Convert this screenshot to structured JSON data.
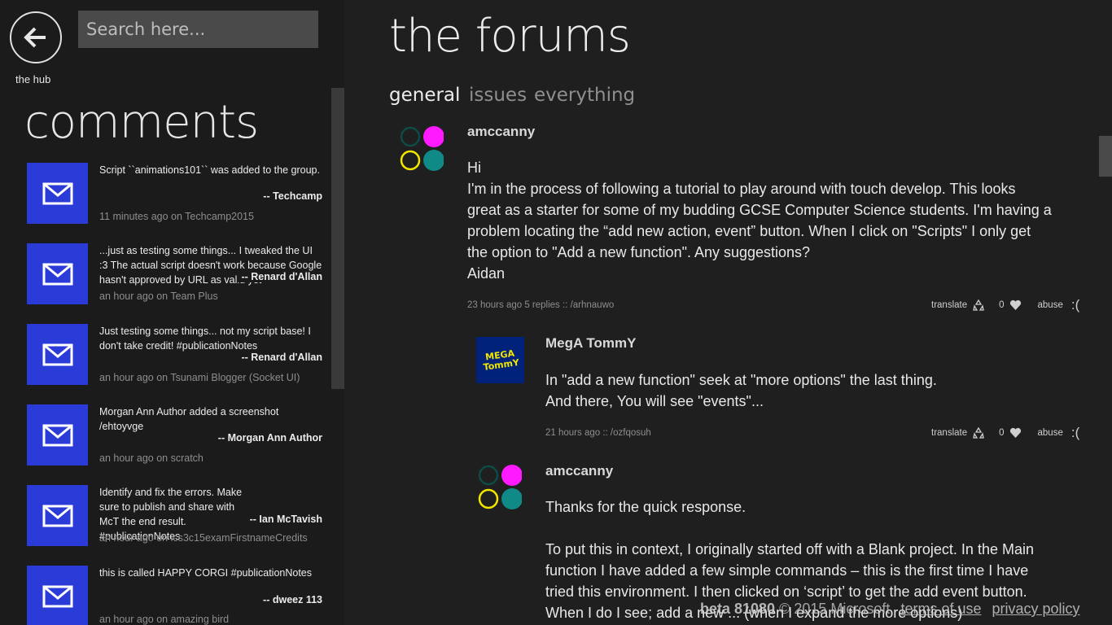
{
  "nav": {
    "back_label": "the hub"
  },
  "search": {
    "placeholder": "Search here..."
  },
  "sidebar": {
    "title": "comments",
    "items": [
      {
        "text": "Script ``animations101`` was added to the group.",
        "author": "-- Techcamp",
        "meta": "11 minutes ago on Techcamp2015"
      },
      {
        "text": "...just as testing some things... I tweaked the UI :3 The actual script doesn't work because Google hasn't approved by URL as valid yet",
        "author": "-- Renard d'Allan",
        "meta": "an hour ago on Team Plus"
      },
      {
        "text": "Just testing some things... not my script base! I don't take credit! #publicationNotes",
        "author": "-- Renard d'Allan",
        "meta": "an hour ago on Tsunami Blogger (Socket UI)"
      },
      {
        "text": "Morgan Ann Author added a screenshot /ehtoyvge",
        "author": "-- Morgan Ann Author",
        "meta": "an hour ago on scratch"
      },
      {
        "text": "Identify and fix the errors. Make sure to publish and share with McT the end result. #publicationNotes",
        "author": "-- Ian McTavish",
        "meta": "an hour ago on ics3c15examFirstnameCredits"
      },
      {
        "text": "this is called HAPPY CORGI #publicationNotes",
        "author": "-- dweez 113",
        "meta": "an hour ago on amazing bird"
      }
    ]
  },
  "main": {
    "title": "the forums",
    "tabs": [
      {
        "label": "general"
      },
      {
        "label": "issues"
      },
      {
        "label": "everything"
      }
    ]
  },
  "posts": [
    {
      "user": "amccanny",
      "lines": [
        "Hi",
        "I'm in the process of following a tutorial to play around with touch develop.  This looks",
        "great as a starter for some of my budding GCSE Computer Science students.  I'm having a",
        "problem locating the “add new action, event” button.  When I click on \"Scripts\" I only get",
        "the option to \"Add a new function\".  Any suggestions?",
        "Aidan"
      ],
      "meta": "23 hours ago 5 replies :: /arhnauwo",
      "translate": "translate",
      "likes": "0",
      "abuse": "abuse",
      "sad": ":("
    },
    {
      "user": "MegA TommY",
      "avatar_text": "MEGA TommY",
      "lines": [
        "In \"add a new function\" seek at \"more options\" the last thing.",
        "And there, You will see \"events\"..."
      ],
      "meta": "21 hours ago :: /ozfqosuh",
      "translate": "translate",
      "likes": "0",
      "abuse": "abuse",
      "sad": ":("
    },
    {
      "user": "amccanny",
      "lines": [
        "Thanks for the quick response.",
        "",
        "To put this in context, I originally started off with a Blank project.  In the Main",
        "function I have added a few simple commands – this is the first time I have",
        "tried this environment.  I then clicked on ‘script’ to get the add event button.",
        "When I do I see; add a new ... (when I expand the more options)"
      ]
    }
  ],
  "footer": {
    "beta": "beta 81080",
    "copyright": "© 2015 Microsoft",
    "terms": "terms of use",
    "privacy": "privacy policy"
  },
  "colors": {
    "tile": "#2b3bd8",
    "dot_magenta": "#ff1aff",
    "dot_teal": "#0f8a86",
    "dot_yellow": "#f2e600",
    "dot_darkteal": "#0d4a48"
  },
  "icons": [
    "back-arrow-icon",
    "envelope-icon",
    "recycle-icon",
    "heart-icon"
  ]
}
